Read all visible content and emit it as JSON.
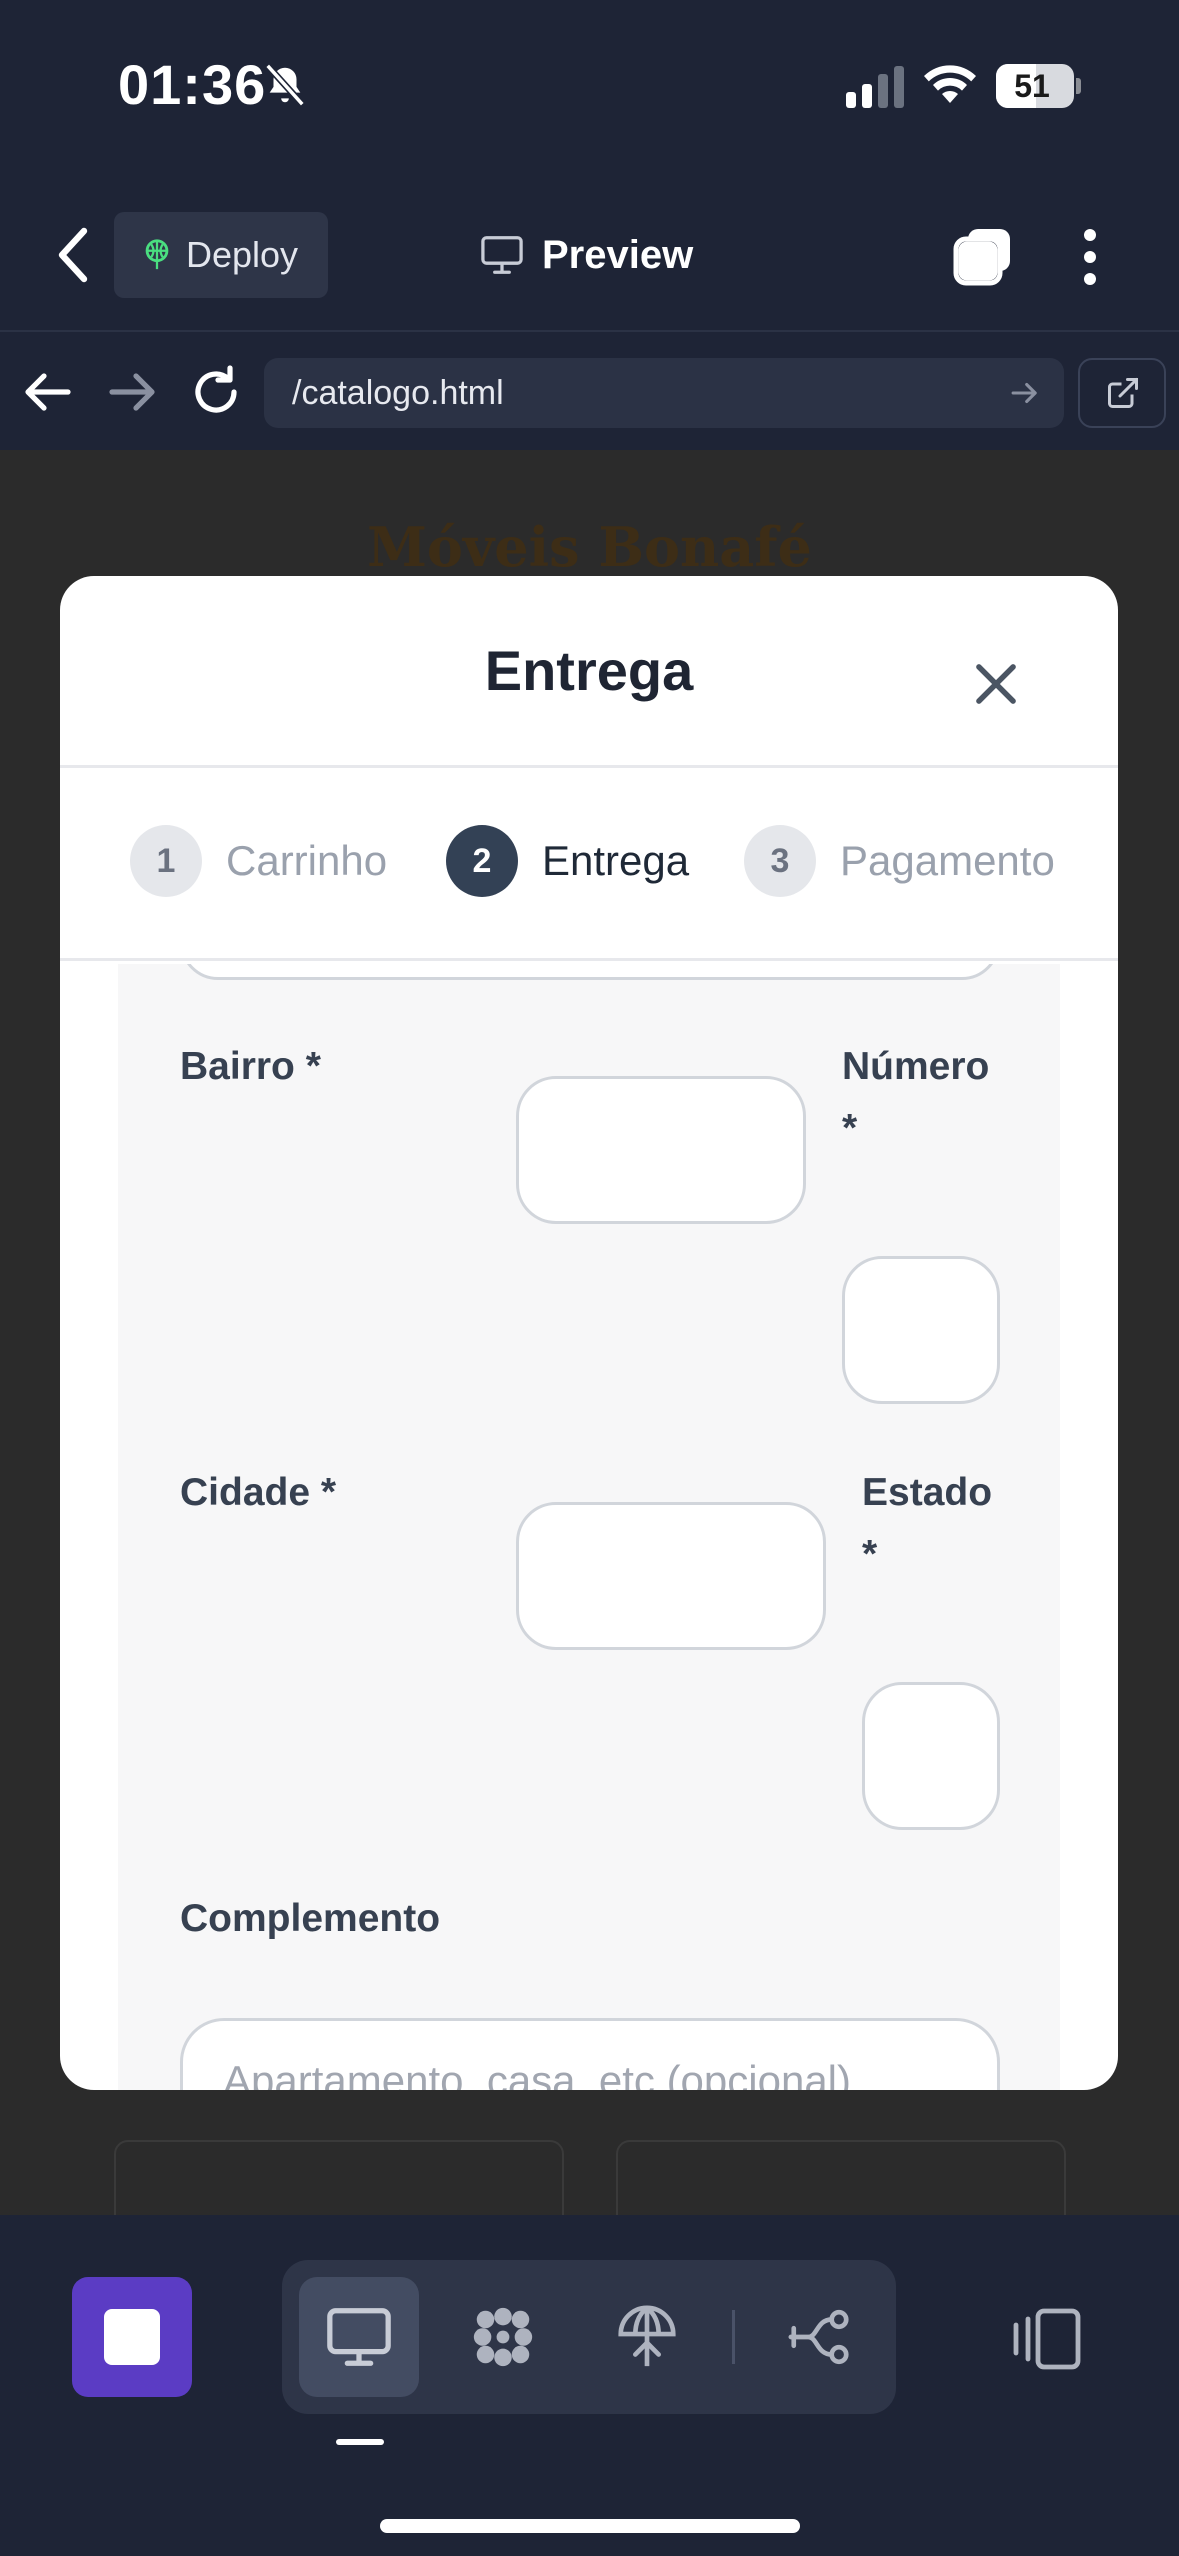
{
  "status_bar": {
    "time": "01:36",
    "battery": "51",
    "battery_level": 0.51
  },
  "app_bar": {
    "deploy_label": "Deploy",
    "preview_label": "Preview"
  },
  "browser": {
    "url": "/catalogo.html"
  },
  "page": {
    "brand": "Móveis Bonafé"
  },
  "modal": {
    "title": "Entrega",
    "steps": [
      {
        "number": "1",
        "label": "Carrinho",
        "state": "inactive"
      },
      {
        "number": "2",
        "label": "Entrega",
        "state": "active"
      },
      {
        "number": "3",
        "label": "Pagamento",
        "state": "inactive"
      }
    ],
    "form": {
      "bairro_label": "Bairro *",
      "numero_label": "Número",
      "numero_required": "*",
      "cidade_label": "Cidade *",
      "estado_label": "Estado",
      "estado_required": "*",
      "complemento_label": "Complemento",
      "complemento_placeholder": "Apartamento, casa, etc (opcional)"
    }
  },
  "colors": {
    "accent": "#5b3cc4",
    "background": "#1e2436",
    "step_active": "#334155",
    "deploy_icon": "#4ade80"
  },
  "icons": [
    "bell-slash-icon",
    "signal-icon",
    "wifi-icon",
    "battery-icon",
    "back-chevron-icon",
    "deploy-tree-icon",
    "monitor-icon",
    "tabs-icon",
    "kebab-icon",
    "arrow-left-icon",
    "arrow-right-icon",
    "reload-icon",
    "external-link-icon",
    "close-icon",
    "stop-icon",
    "grid-dots-icon",
    "globe-deploy-icon",
    "flow-icon",
    "panel-icon"
  ]
}
